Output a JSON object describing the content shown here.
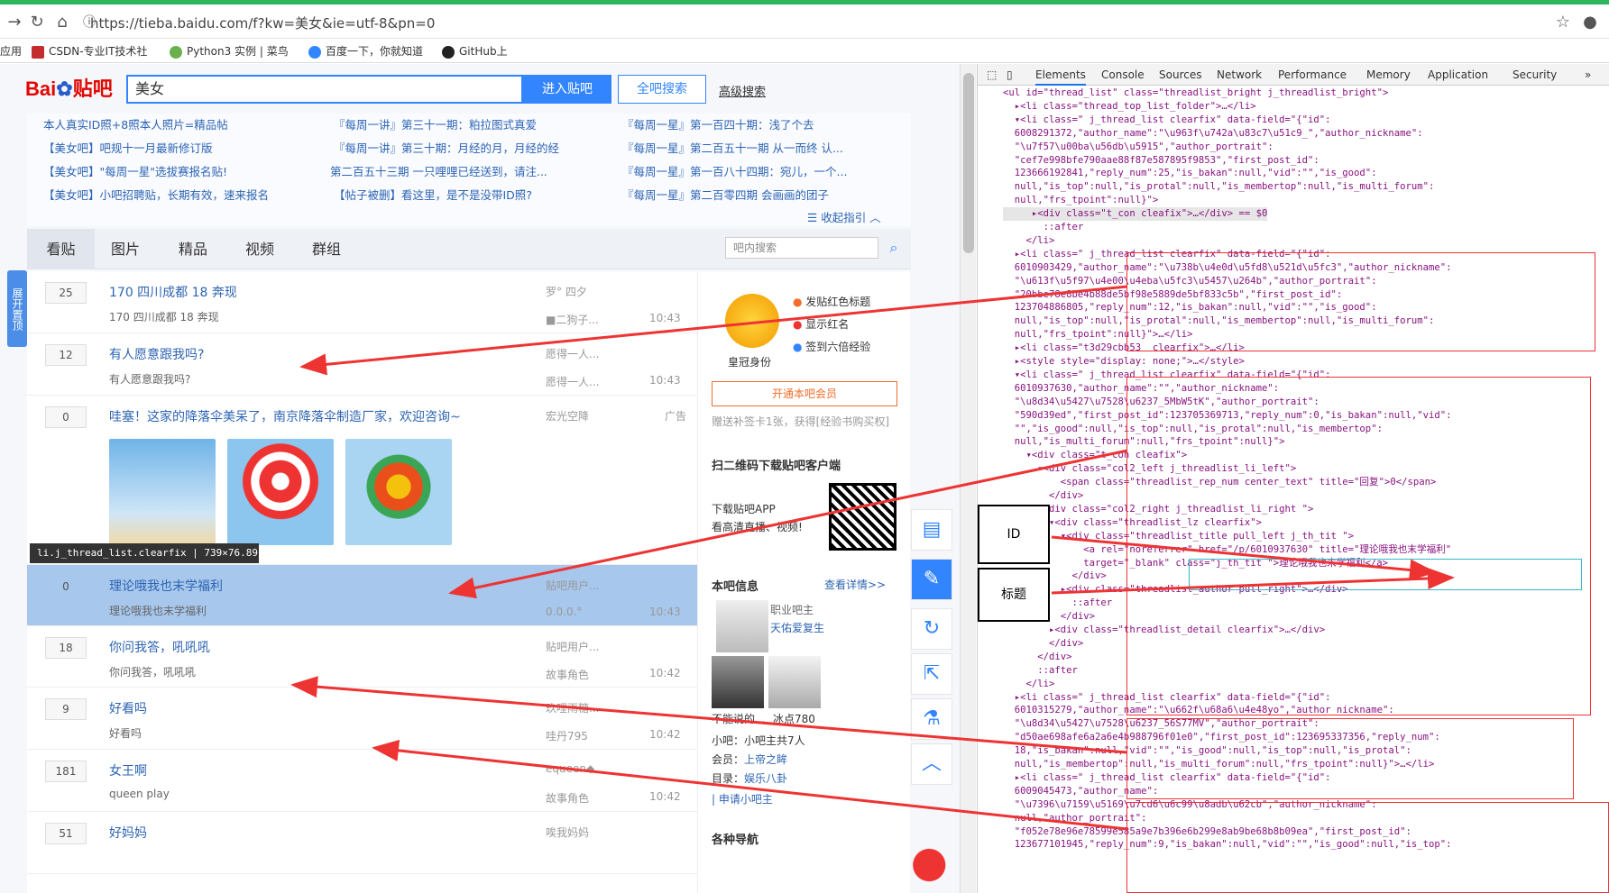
{
  "browser": {
    "url": "https://tieba.baidu.com/f?kw=美女&ie=utf-8&pn=0",
    "bookmarks": [
      {
        "label": "应用"
      },
      {
        "label": "CSDN-专业IT技术社"
      },
      {
        "label": "Python3 实例 | 菜鸟"
      },
      {
        "label": "百度一下，你就知道"
      },
      {
        "label": "GitHub上"
      }
    ]
  },
  "header": {
    "logo": "Bai",
    "logo2": "贴吧",
    "search_value": "美女",
    "enter_button": "进入贴吧",
    "all_search_button": "全吧搜索",
    "advanced": "高级搜索"
  },
  "notice": {
    "links": [
      "本人真实ID照+8照本人照片=精品帖",
      "『每周一讲』第三十一期：粕拉图式真爱",
      "『每周一星』第一百四十期：浅了个去",
      "【美女吧】吧规十一月最新修订版",
      "『每周一讲』第三十期：月经的月，月经的经",
      "『每周一星』第二百五十一期 从一而终 认...",
      "【美女吧】\"每周一星\"选拔赛报名贴!",
      "第二百五十三期 一只哩哩已经送到，请注...",
      "『每周一星』第一百八十四期：宛儿，一个...",
      "【美女吧】小吧招聘贴，长期有效，速来报名",
      "【帖子被删】看这里，是不是没带ID照?",
      "『每周一星』第二百零四期 会画画的团子"
    ],
    "collapse": "收起指引"
  },
  "tabs": [
    "看贴",
    "图片",
    "精品",
    "视频",
    "群组"
  ],
  "inner_search_placeholder": "吧内搜索",
  "side_float": "展开置顶",
  "threads": [
    {
      "num": "25",
      "title": "170 四川成都 18 奔现",
      "sub": "170 四川成都 18 奔现",
      "author": "罗° 四夕",
      "last": "■二狗子...",
      "time": "10:43"
    },
    {
      "num": "12",
      "title": "有人愿意跟我吗?",
      "sub": "有人愿意跟我吗?",
      "author": "愿得一人...",
      "last": "愿得一人...",
      "time": "10:43"
    },
    {
      "num": "0",
      "title": "哇塞！这家的降落伞美呆了，南京降落伞制造厂家，欢迎咨询~",
      "sub": "",
      "author": "宏光空降",
      "last": "",
      "time": "广告"
    },
    {
      "num": "0",
      "title": "理论哦我也末学福利",
      "sub": "理论哦我也末学福利",
      "author": "贴吧用户...",
      "last": "0.0.0.°",
      "time": "10:43"
    },
    {
      "num": "18",
      "title": "你问我答，吼吼吼",
      "sub": "你问我答，吼吼吼",
      "author": "贴吧用户...",
      "last": "故事角色",
      "time": "10:42"
    },
    {
      "num": "9",
      "title": "好看吗",
      "sub": "好看吗",
      "author": "玖哩雨糖...",
      "last": "哇丹795",
      "time": "10:42"
    },
    {
      "num": "181",
      "title": "女王啊",
      "sub": "queen play",
      "author": "equeen◆",
      "last": "故事角色",
      "time": "10:42"
    },
    {
      "num": "51",
      "title": "好妈妈",
      "sub": "",
      "author": "唉我妈妈",
      "last": "",
      "time": ""
    }
  ],
  "tooltip": "li.j_thread_list.clearfix | 739×76.89",
  "right_panel": {
    "perk1": "发贴红色标题",
    "perk2": "显示红名",
    "perk3": "签到六倍经验",
    "crown_label": "皇冠身份",
    "member_btn": "开通本吧会员",
    "member_note": "赠送补签卡1张，获得[经验书购买权]",
    "qr_title": "扫二维码下载贴吧客户端",
    "qr_text1": "下载贴吧APP",
    "qr_text2": "看高清直播、视频!",
    "info_title": "本吧信息",
    "info_more": "查看详情>>",
    "role1": "职业吧主",
    "name1": "天佑爱复生",
    "mod1": "不能说的...",
    "mod2": "冰点780",
    "small": "小吧：小吧主共7人",
    "member": "会员：",
    "member_name": "上帝之眸",
    "dir": "目录：",
    "dir_name": "娱乐八卦",
    "apply": "申请小吧主",
    "nav": "各种导航"
  },
  "devtools": {
    "tabs": [
      "Elements",
      "Console",
      "Sources",
      "Network",
      "Performance",
      "Memory",
      "Application",
      "Security"
    ],
    "lines": [
      "<ul id=\"thread_list\" class=\"threadlist_bright j_threadlist_bright\">",
      "  ▸<li class=\"thread_top_list_folder\">…</li>",
      "  ▾<li class=\" j_thread_list clearfix\" data-field=\"{\"id\":",
      "  6008291372,\"author_name\":\"\\u963f\\u742a\\u83c7\\u51c9_\",\"author_nickname\":",
      "  \"\\u7f57\\u00ba\\u56db\\u5915\",\"author_portrait\":",
      "  \"cef7e998bfe790aae88f87e587895f9853\",\"first_post_id\":",
      "  123666192841,\"reply_num\":25,\"is_bakan\":null,\"vid\":\"\",\"is_good\":",
      "  null,\"is_top\":null,\"is_protal\":null,\"is_membertop\":null,\"is_multi_forum\":",
      "  null,\"frs_tpoint\":null}\">",
      "     ▸<div class=\"t_con cleafix\">…</div> == $0",
      "       ::after",
      "    </li>",
      "  ▸<li class=\" j_thread_list clearfix\" data-field=\"{\"id\":",
      "  6010903429,\"author_name\":\"\\u738b\\u4e0d\\u5fd8\\u521d\\u5fc3\",\"author_nickname\":",
      "  \"\\u613f\\u5f97\\u4e00\\u4eba\\u5fc3\\u5457\\u264b\",\"author_portrait\":",
      "  \"20bbe78e8be4b88de5bf98e5889de5bf833c5b\",\"first_post_id\":",
      "  123704886805,\"reply_num\":12,\"is_bakan\":null,\"vid\":\"\",\"is_good\":",
      "  null,\"is_top\":null,\"is_protal\":null,\"is_membertop\":null,\"is_multi_forum\":",
      "  null,\"frs_tpoint\":null}\">…</li>",
      "  ▸<li class=\"t3d29cbb53  clearfix\">…</li>",
      "  ▸<style style=\"display: none;\">…</style>",
      "  ▾<li class=\" j_thread_list clearfix\" data-field=\"{\"id\":",
      "  6010937630,\"author_name\":\"\",\"author_nickname\":",
      "  \"\\u8d34\\u5427\\u7528\\u6237_5MbW5tK\",\"author_portrait\":",
      "  \"590d39ed\",\"first_post_id\":123705369713,\"reply_num\":0,\"is_bakan\":null,\"vid\":",
      "  \"\",\"is_good\":null,\"is_top\":null,\"is_protal\":null,\"is_membertop\":",
      "  null,\"is_multi_forum\":null,\"frs_tpoint\":null}\">",
      "    ▾<div class=\"t_con cleafix\">",
      "      ▾<div class=\"col2_left j_threadlist_li_left\">",
      "          <span class=\"threadlist_rep_num center_text\" title=\"回复\">0</span>",
      "        </div>",
      "      ▾<div class=\"col2_right j_threadlist_li_right \">",
      "        ▾<div class=\"threadlist_lz clearfix\">",
      "          ▾<div class=\"threadlist_title pull_left j_th_tit \">",
      "              <a rel=\"noreferrer\" href=\"/p/6010937630\" title=\"理论哦我也末学福利\"",
      "              target=\"_blank\" class=\"j_th_tit \">理论哦我也末学福利</a>",
      "            </div>",
      "          ▸<div class=\"threadlist_author pull_right\">…</div>",
      "            ::after",
      "          </div>",
      "        ▸<div class=\"threadlist_detail clearfix\">…</div>",
      "        </div>",
      "      </div>",
      "      ::after",
      "    </li>",
      "  ▸<li class=\" j_thread_list clearfix\" data-field=\"{\"id\":",
      "  6010315279,\"author_name\":\"\\u662f\\u68a6\\u4e48yo\",\"author_nickname\":",
      "  \"\\u8d34\\u5427\\u7528\\u6237_56S77MV\",\"author_portrait\":",
      "  \"d50ae698afe6a2a6e4b988796f01e0\",\"first_post_id\":123695337356,\"reply_num\":",
      "  18,\"is_bakan\":null,\"vid\":\"\",\"is_good\":null,\"is_top\":null,\"is_protal\":",
      "  null,\"is_membertop\":null,\"is_multi_forum\":null,\"frs_tpoint\":null}\">…</li>",
      "  ▸<li class=\" j_thread_list clearfix\" data-field=\"{\"id\":",
      "  6009045473,\"author_name\":",
      "  \"\\u7396\\u7159\\u5169\\u7cd6\\u6c99\\u8adb\\u62cb\",\"author_nickname\":",
      "  null,\"author_portrait\":",
      "  \"f052e78e96e78599e585a9e7b396e6b299e8ab9be68b8b09ea\",\"first_post_id\":",
      "  123677101945,\"reply_num\":9,\"is_bakan\":null,\"vid\":\"\",\"is_good\":null,\"is_top\":"
    ]
  },
  "labels": {
    "id": "ID",
    "title": "标题"
  }
}
